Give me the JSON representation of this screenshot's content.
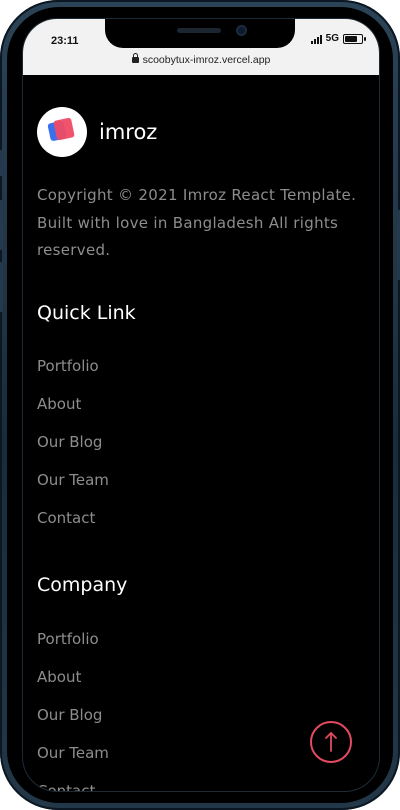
{
  "status_bar": {
    "time": "23:11",
    "network": "5G",
    "battery_level": 0.75
  },
  "browser": {
    "url": "scoobytux-imroz.vercel.app"
  },
  "footer": {
    "brand_name": "imroz",
    "copyright": "Copyright © 2021 Imroz React Template. Built with love in Bangladesh All rights reserved.",
    "quick_link": {
      "title": "Quick Link",
      "items": [
        "Portfolio",
        "About",
        "Our Blog",
        "Our Team",
        "Contact"
      ]
    },
    "company": {
      "title": "Company",
      "items": [
        "Portfolio",
        "About",
        "Our Blog",
        "Our Team",
        "Contact"
      ]
    }
  },
  "colors": {
    "background": "#000000",
    "text_muted": "#8d8d8d",
    "accent": "#e44a60",
    "logo_blue": "#3a6ff0"
  },
  "icons": {
    "lock": "lock-icon",
    "scroll_top": "arrow-up-icon"
  }
}
